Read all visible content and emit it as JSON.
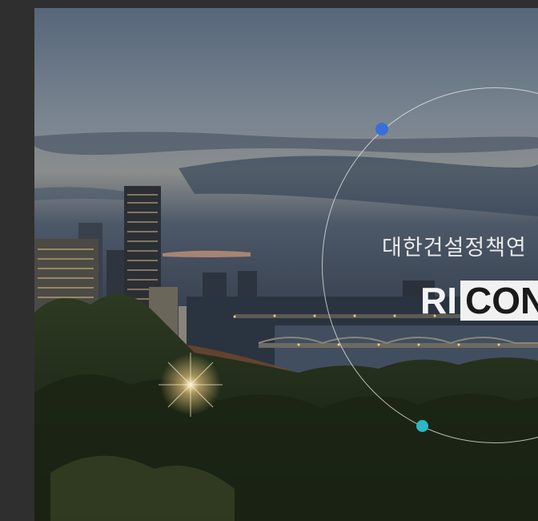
{
  "hero": {
    "tagline": "대한건설정책연",
    "brand_plain": "RI",
    "brand_boxed": "CON"
  },
  "colors": {
    "frame_bg": "#2f2f2f",
    "ring": "#ebebeb",
    "dot_blue": "#3a6fd8",
    "dot_teal": "#29b8c6"
  }
}
